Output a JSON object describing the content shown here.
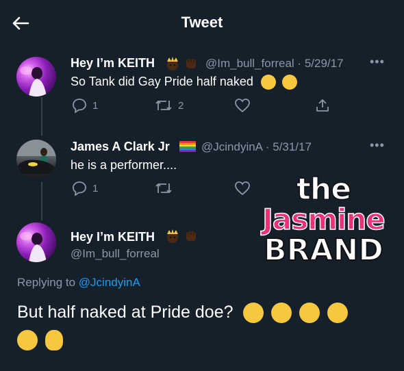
{
  "header": {
    "title": "Tweet"
  },
  "thread": [
    {
      "name": "Hey I’m KEITH",
      "handle": "@Im_bull_forreal",
      "date": "5/29/17",
      "text": "So Tank did Gay Pride half naked",
      "name_emoji": [
        "crown-face",
        "fist"
      ],
      "text_emoji": [
        "thinking",
        "worried"
      ],
      "replies": "1",
      "retweets": "2",
      "likes": "",
      "more": "•••"
    },
    {
      "name": "James A Clark Jr",
      "handle": "@JcindyinA",
      "date": "5/31/17",
      "text": "he is a performer....",
      "name_emoji": [
        "rainbow-flag"
      ],
      "replies": "1",
      "retweets": "",
      "likes": "",
      "more": "•••"
    }
  ],
  "focused": {
    "name": "Hey I’m KEITH",
    "handle": "@Im_bull_forreal",
    "name_emoji": [
      "crown-face",
      "fist"
    ],
    "replying_prefix": "Replying to",
    "replying_handle": "@JcindyinA",
    "text": "But half naked at Pride doe?",
    "text_emoji": [
      "loudly-crying",
      "loudly-crying",
      "loudly-crying",
      "loudly-crying",
      "loudly-crying",
      "ok-hand"
    ]
  },
  "watermark": {
    "line1": "the",
    "line2": "Jasmine",
    "line3": "BRAND"
  },
  "colors": {
    "background": "#15202b",
    "secondary": "#8b98a5",
    "link": "#1d9bf0",
    "thread_line": "#38444d",
    "watermark_pink": "#e8327a"
  }
}
